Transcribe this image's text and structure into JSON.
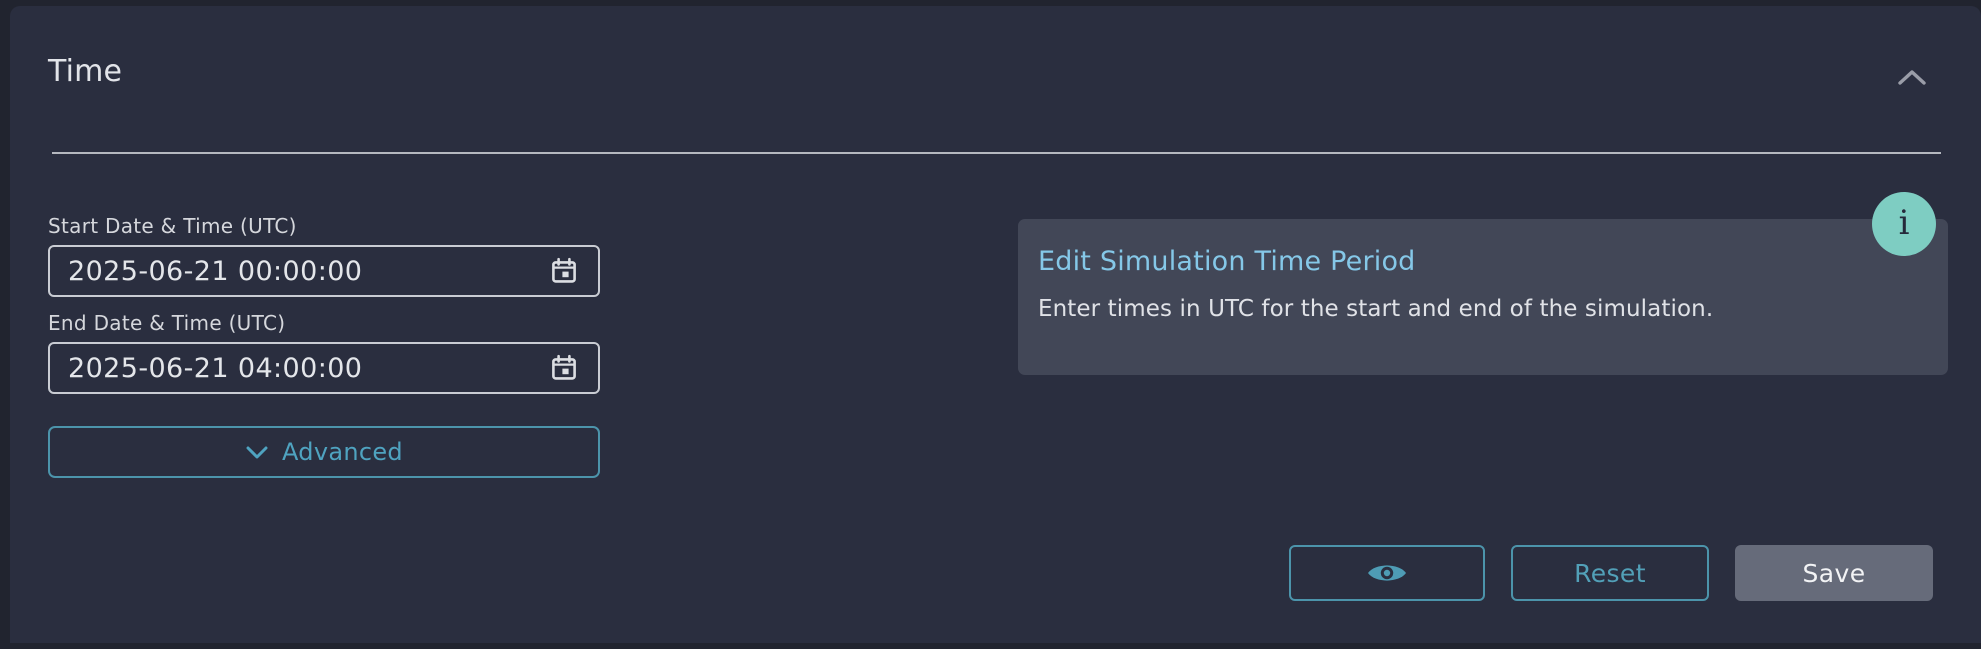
{
  "panel": {
    "title": "Time",
    "collapse_icon": "chevron-up-icon",
    "accent_teal": "#4c94ab",
    "background": "#2a2e3f",
    "outer_background": "#21242f",
    "divider_color": "#b5b8bf"
  },
  "form": {
    "start": {
      "label": "Start Date & Time (UTC)",
      "value": "2025-06-21  00:00:00",
      "icon": "calendar-icon"
    },
    "end": {
      "label": "End Date & Time (UTC)",
      "value": "2025-06-21  04:00:00",
      "icon": "calendar-icon"
    },
    "advanced": {
      "label": "Advanced",
      "icon": "chevron-down-icon"
    }
  },
  "info": {
    "button_glyph": "i",
    "button_icon": "info-icon",
    "button_color": "#7ecdc2",
    "tooltip": {
      "title": "Edit Simulation Time Period",
      "title_color": "#85c8e8",
      "body": "Enter times in UTC for the start and end of the simulation.",
      "background": "#424757"
    }
  },
  "footer": {
    "preview": {
      "label": "",
      "icon": "eye-icon"
    },
    "reset": {
      "label": "Reset"
    },
    "save": {
      "label": "Save",
      "background": "#666b7a"
    }
  }
}
